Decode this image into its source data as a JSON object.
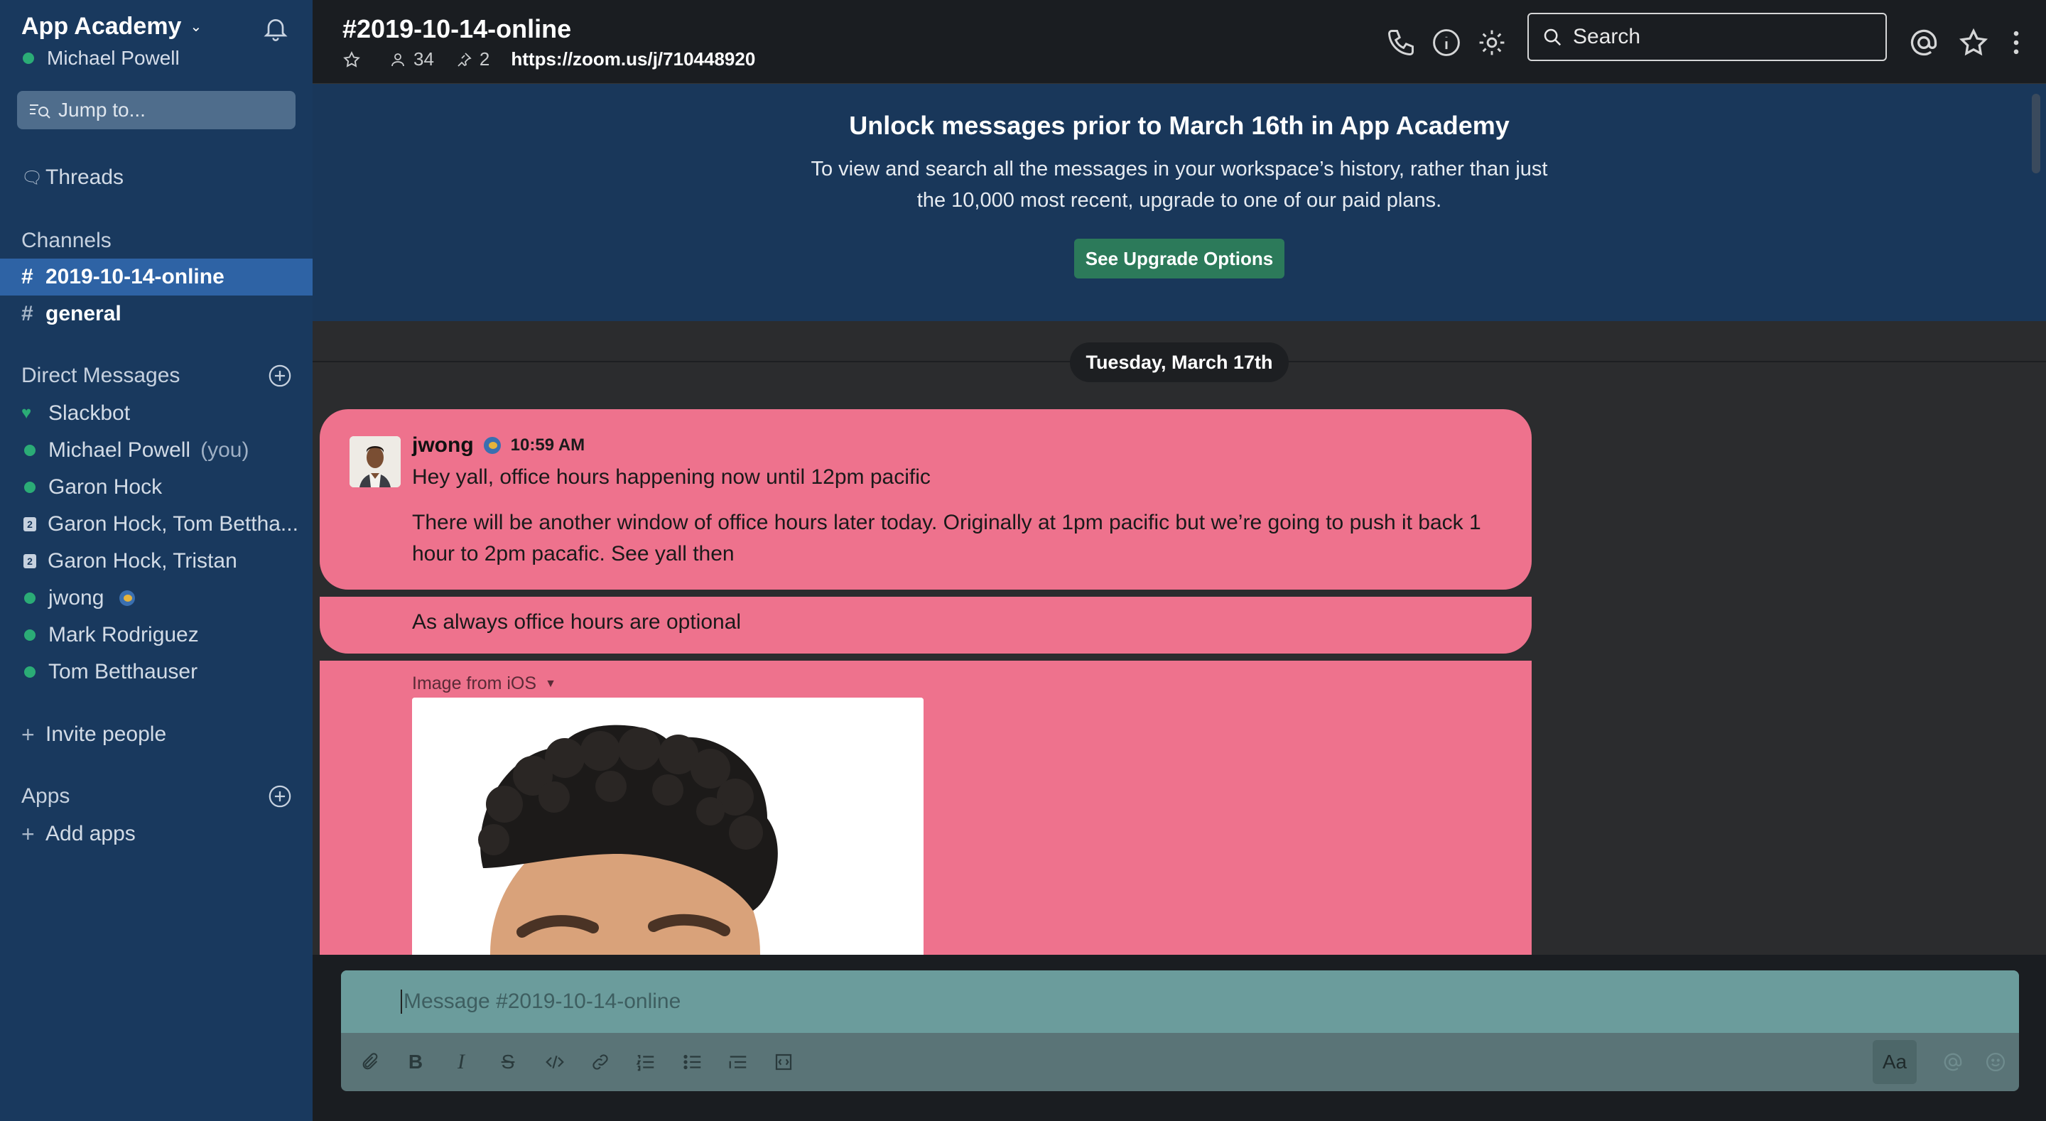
{
  "workspace": {
    "name": "App Academy",
    "user": "Michael Powell"
  },
  "sidebar": {
    "jump_placeholder": "Jump to...",
    "threads_label": "Threads",
    "channels_header": "Channels",
    "channels": [
      {
        "name": "2019-10-14-online",
        "active": true
      },
      {
        "name": "general",
        "bold": true
      }
    ],
    "dm_header": "Direct Messages",
    "dms": [
      {
        "name": "Slackbot",
        "kind": "heart"
      },
      {
        "name": "Michael Powell",
        "suffix": "(you)",
        "kind": "dot"
      },
      {
        "name": "Garon Hock",
        "kind": "dot"
      },
      {
        "name": "Garon Hock, Tom Bettha...",
        "kind": "group",
        "count": "2"
      },
      {
        "name": "Garon Hock, Tristan",
        "kind": "group",
        "count": "2"
      },
      {
        "name": "jwong",
        "kind": "dot"
      },
      {
        "name": "Mark Rodriguez",
        "kind": "dot"
      },
      {
        "name": "Tom Betthauser",
        "kind": "dot"
      }
    ],
    "invite_label": "Invite people",
    "apps_header": "Apps",
    "add_apps_label": "Add apps"
  },
  "header": {
    "channel_title": "#2019-10-14-online",
    "members_count": "34",
    "pins_count": "2",
    "topic_link": "https://zoom.us/j/710448920",
    "search_placeholder": "Search"
  },
  "banner": {
    "title": "Unlock messages prior to March 16th in App Academy",
    "body": "To view and search all the messages in your workspace’s history, rather than just the 10,000 most recent, upgrade to one of our paid plans.",
    "button": "See Upgrade Options"
  },
  "day_divider": "Tuesday, March 17th",
  "messages": {
    "author": "jwong",
    "time": "10:59 AM",
    "lines": [
      "Hey yall, office hours happening now until 12pm pacific",
      "There will be another window of office hours later today. Originally at 1pm pacific but we’re going to push it back 1 hour to 2pm pacafic. See yall then",
      "As always office hours are optional"
    ],
    "file_label": "Image from iOS"
  },
  "composer": {
    "placeholder": "Message #2019-10-14-online",
    "format_label": "Aa"
  },
  "colors": {
    "sidebar_bg": "#19395e",
    "active_channel": "#2e63a5",
    "message_highlight": "#ee728d",
    "upgrade_button": "#2c7a5a",
    "presence": "#2bac76"
  }
}
